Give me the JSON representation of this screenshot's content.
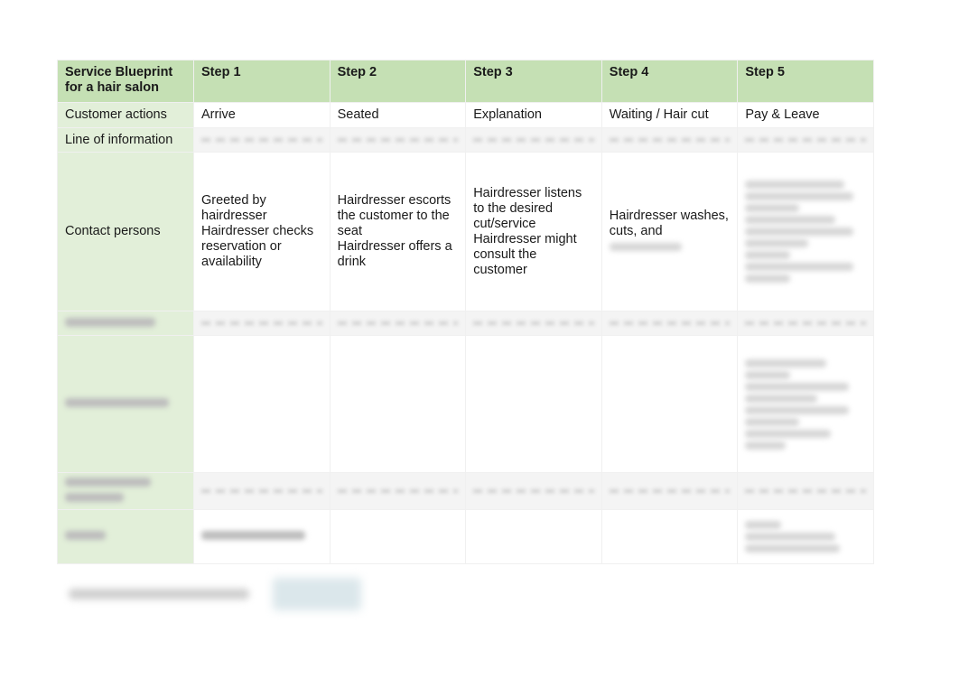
{
  "document": {
    "table": {
      "header": {
        "title": "Service Blueprint for a hair salon",
        "steps": [
          "Step 1",
          "Step 2",
          "Step 3",
          "Step 4",
          "Step 5"
        ]
      },
      "rows": [
        {
          "label": "Customer actions",
          "cells": [
            "Arrive",
            "Seated",
            "Explanation",
            "Waiting / Hair cut",
            "Pay & Leave"
          ]
        },
        {
          "label": "Line of information",
          "cells": [
            "",
            "",
            "",
            "",
            ""
          ]
        },
        {
          "label": "Contact persons",
          "cells": [
            "Greeted by hairdresser\nHairdresser checks reservation or availability",
            "Hairdresser escorts the customer to the seat\nHairdresser offers a drink",
            "Hairdresser listens to the desired cut/service\nHairdresser might consult the customer",
            "Hairdresser washes, cuts, and",
            ""
          ]
        }
      ]
    }
  }
}
